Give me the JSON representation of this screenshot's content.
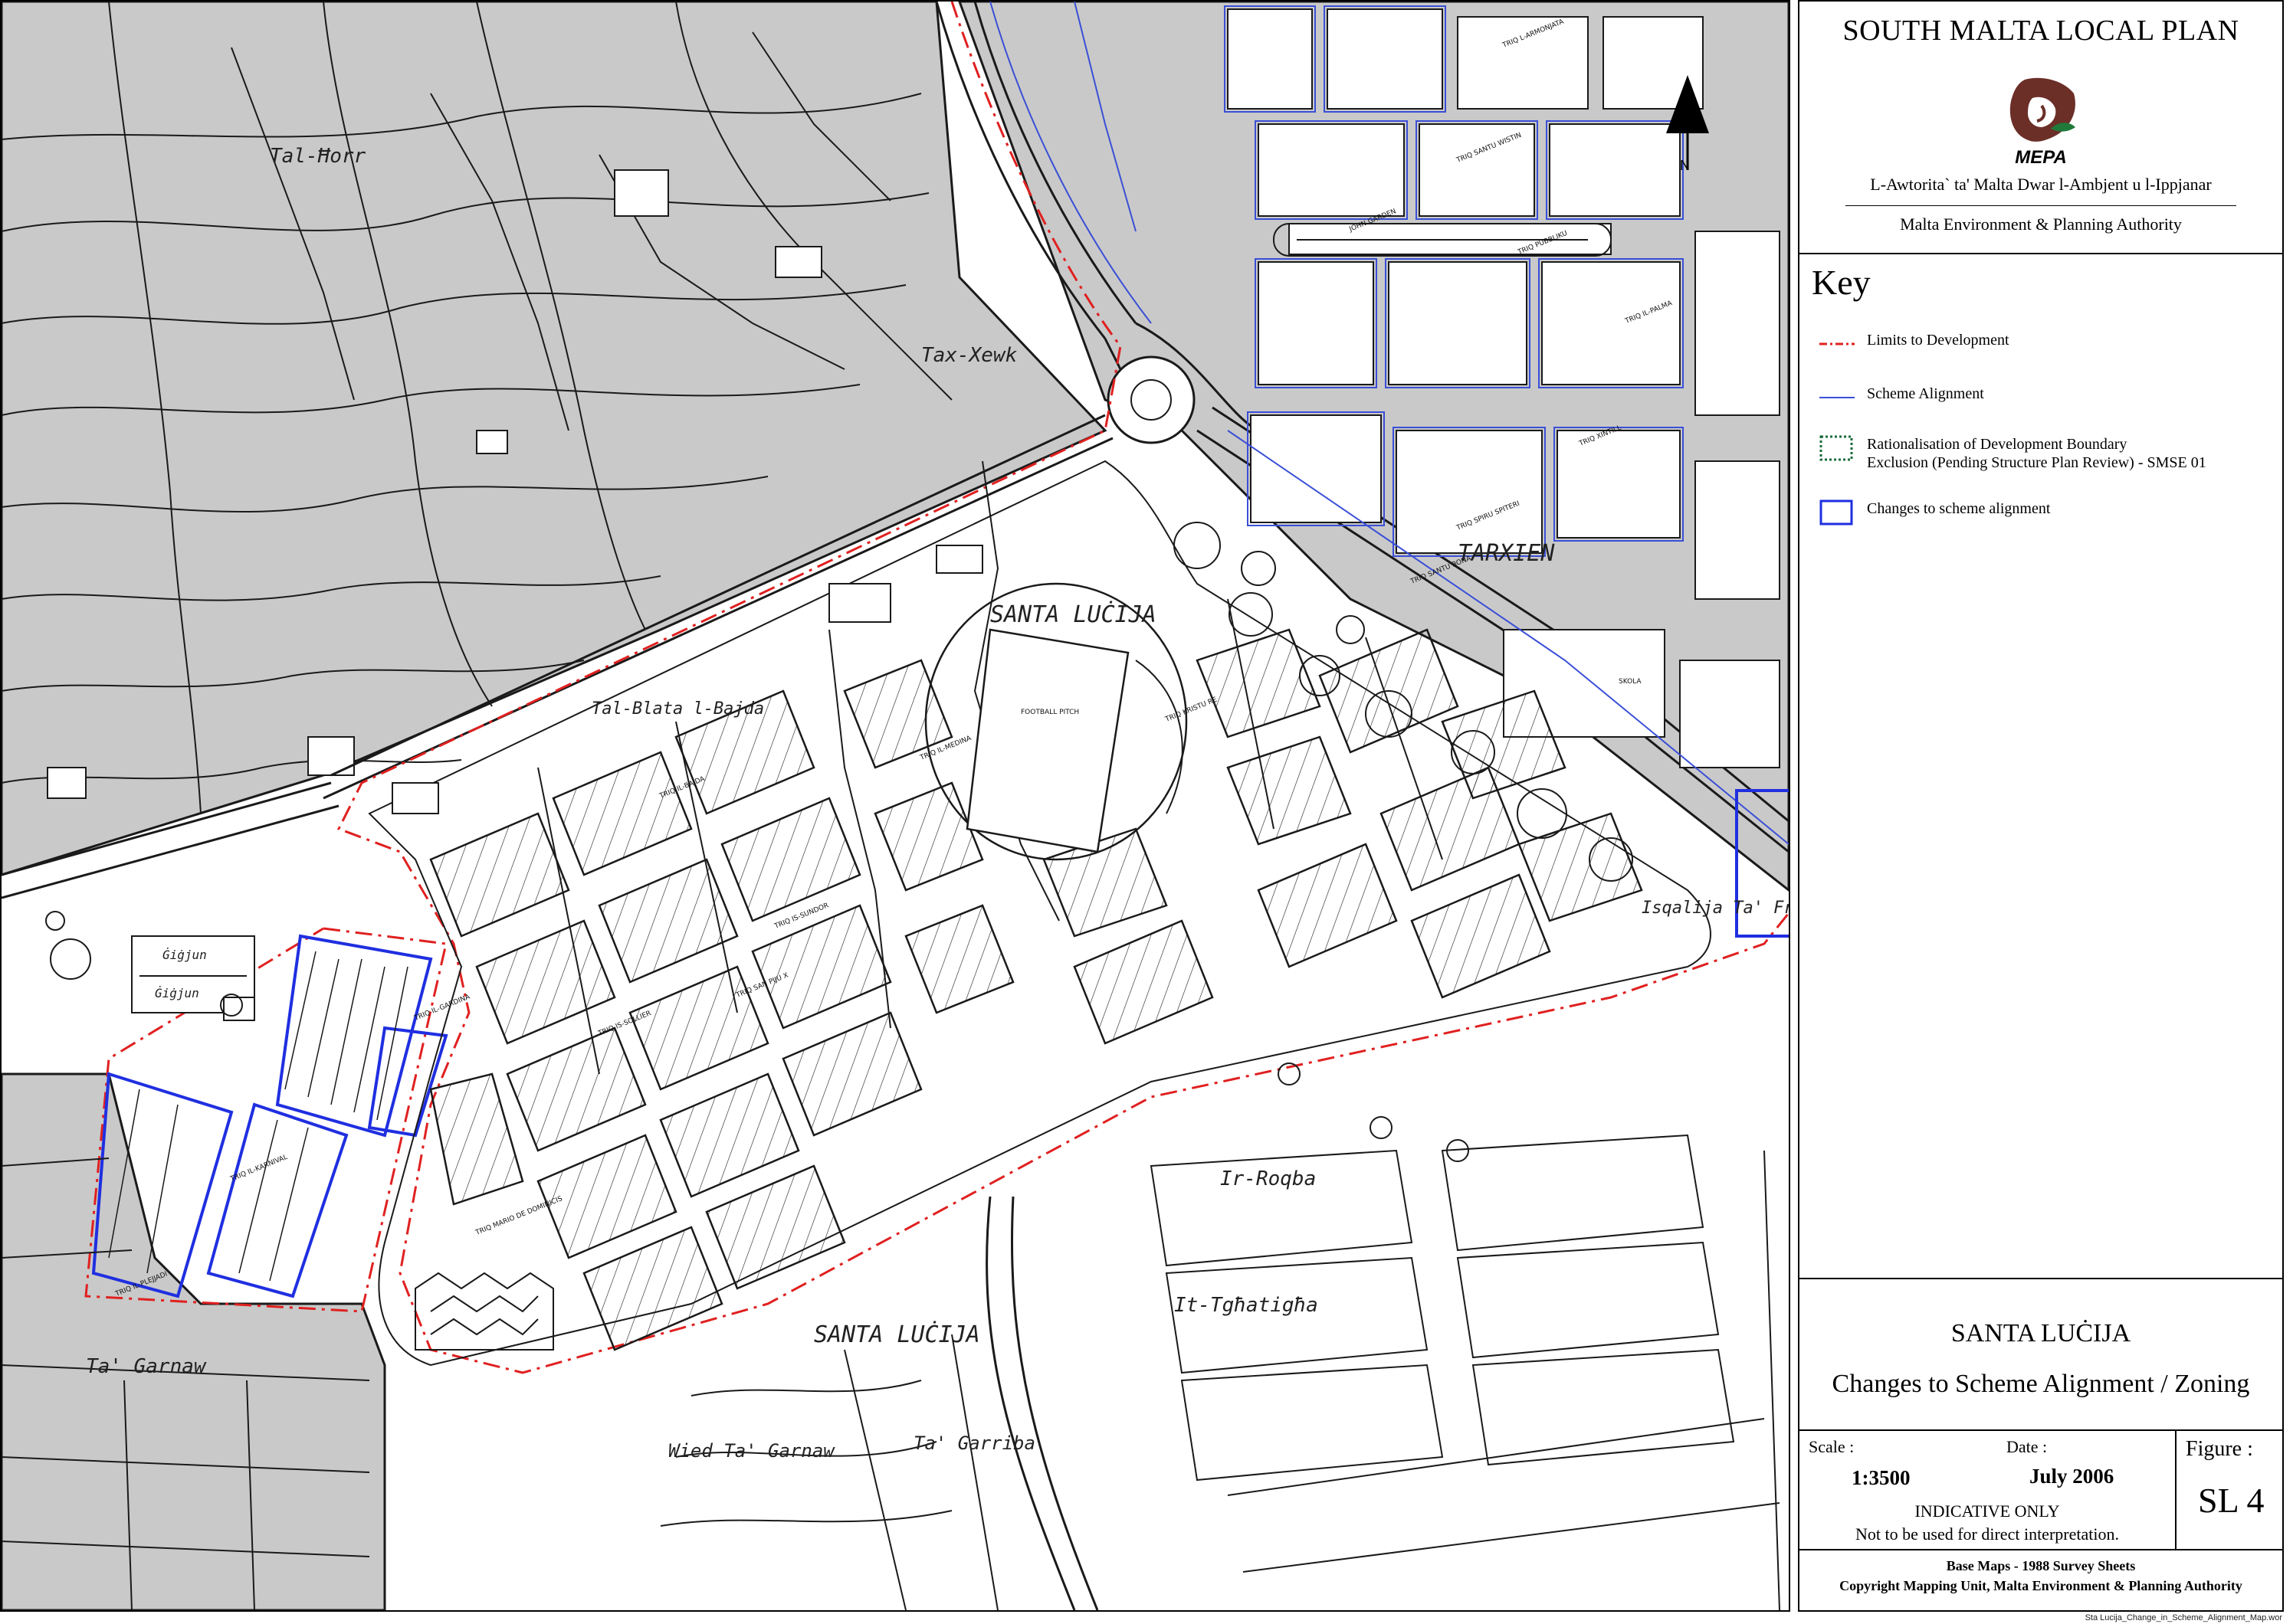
{
  "header": {
    "plan_title": "SOUTH MALTA LOCAL PLAN",
    "logo_text": "MEPA",
    "authority_mt": "L-Awtorita` ta' Malta Dwar l-Ambjent u l-Ippjanar",
    "authority_en": "Malta Environment & Planning Authority"
  },
  "key": {
    "title": "Key",
    "items": [
      {
        "label": "Limits to Development",
        "symbol": "red-dash-dot-line",
        "color": "#e02020"
      },
      {
        "label": "Scheme Alignment",
        "symbol": "blue-line",
        "color": "#3a4fd6"
      },
      {
        "label": "Rationalisation of Development Boundary",
        "label2": "Exclusion (Pending Structure Plan Review) - SMSE 01",
        "symbol": "green-dotted-box",
        "color": "#1a6b3a"
      },
      {
        "label": "Changes to scheme alignment",
        "symbol": "blue-box",
        "color": "#1f2fe0"
      }
    ]
  },
  "title_block": {
    "place": "SANTA LUĊIJA",
    "subtitle": "Changes to Scheme Alignment / Zoning"
  },
  "info": {
    "scale_label": "Scale :",
    "scale_value": "1:3500",
    "date_label": "Date :",
    "date_value": "July 2006",
    "figure_label": "Figure :",
    "figure_value": "SL 4",
    "indicative": "INDICATIVE ONLY",
    "not_used": "Not to be used for direct interpretation."
  },
  "footer": {
    "base_maps": "Base Maps - 1988 Survey Sheets",
    "copyright": "Copyright Mapping Unit, Malta Environment & Planning Authority",
    "filename": "Sta Lucija_Change_in_Scheme_Alignment_Map.wor"
  },
  "map": {
    "colors": {
      "zone_grey": "#c9c9c9",
      "line": "#1a1a1a",
      "limits": "#e02020",
      "scheme": "#3a4fd6"
    },
    "place_labels": [
      "Tal-Ħorr",
      "Tax-Xewk",
      "SANTA LUĊIJA",
      "Tal-Blata l-Bajda",
      "Ġiġjun",
      "Ġiġjun",
      "Ta' Garnaw",
      "SANTA LUĊIJA",
      "Wied Ta' Garnaw",
      "Ta' Garriba",
      "Ir-Roqba",
      "It-Tgħatigħa",
      "Isqalija Ta' Fra",
      "TARXIEN"
    ],
    "feature_labels": [
      "FOOTBALL PITCH",
      "SKOLA"
    ],
    "street_labels": [
      "TRIQ IL-GARDINA",
      "TRIQ IL-KARNIVAL",
      "TRIQ IL-PLEJJADI",
      "TRIQ MARIO DE DOMINICIS",
      "TRIQ IS-SOLLIER",
      "TRIQ SAN PIJU X",
      "TRIQ IL-BAJDA",
      "TRIQ IL-MEDINA",
      "TRIQ IS-SUNDOR",
      "TRIQ KRISTU RE",
      "TRIQ SPIRU SPITERI",
      "TRIQ SANTU BONA",
      "TRIQ XINTILL",
      "JOHN GARDEN",
      "TRIQ PUBBLIKU",
      "TRIQ SANTU WISTIN",
      "TRIQ L-ARMONJATA",
      "TRIQ IL-PALMA"
    ]
  }
}
